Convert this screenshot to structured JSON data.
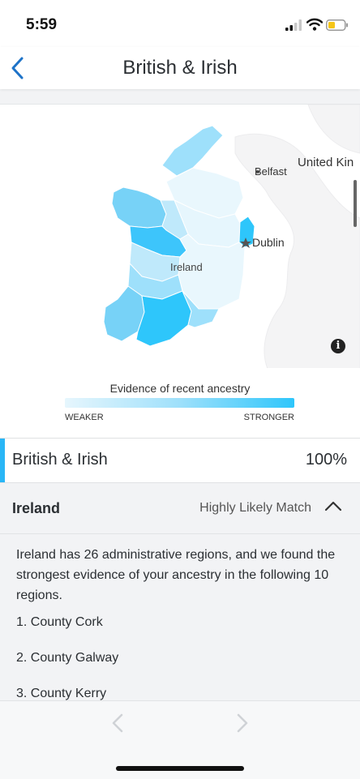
{
  "status_bar": {
    "time": "5:59",
    "icons": [
      "signal-icon",
      "wifi-icon",
      "battery-icon"
    ]
  },
  "nav": {
    "title": "British & Irish",
    "back_icon": "chevron-left-icon"
  },
  "map": {
    "labels": {
      "belfast": "Belfast",
      "united_kingdom": "United Kin",
      "dublin": "Dublin",
      "ireland": "Ireland"
    },
    "info_icon": "i",
    "colors": {
      "weaker": "#e6f6fd",
      "medium": "#9ee0fb",
      "stronger": "#2ec6fb"
    }
  },
  "legend": {
    "title": "Evidence of recent ancestry",
    "weaker": "WEAKER",
    "stronger": "STRONGER"
  },
  "region": {
    "name": "British & Irish",
    "percent": "100%",
    "accent_color": "#29b6f6"
  },
  "detail": {
    "title": "Ireland",
    "match": "Highly Likely Match",
    "description": "Ireland has 26 administrative regions, and we found the strongest evidence of your ancestry in the following 10 regions.",
    "counties": [
      "1. County Cork",
      "2. County Galway",
      "3. County Kerry"
    ]
  },
  "pager": {
    "prev_icon": "chevron-left-icon",
    "next_icon": "chevron-right-icon"
  }
}
